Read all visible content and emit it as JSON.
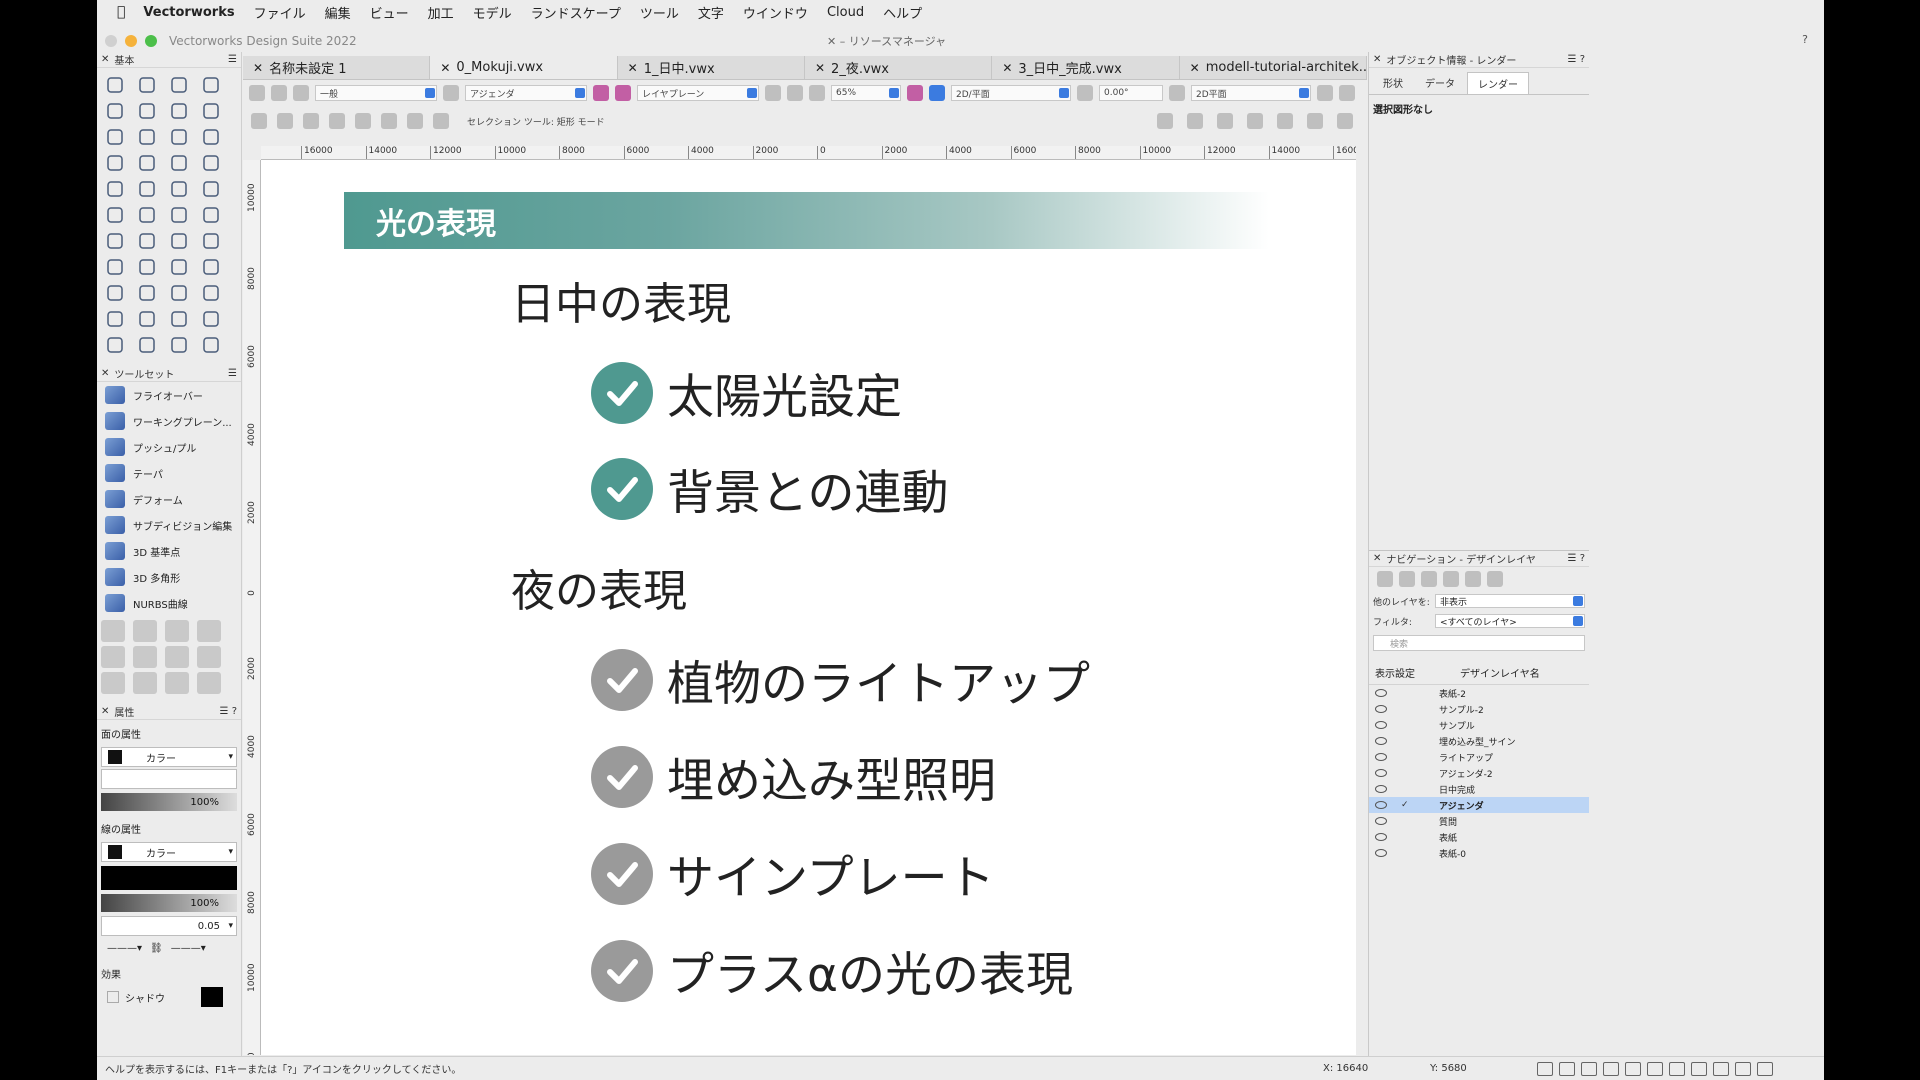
{
  "menubar": {
    "app": "Vectorworks",
    "items": [
      "ファイル",
      "編集",
      "ビュー",
      "加工",
      "モデル",
      "ランドスケープ",
      "ツール",
      "文字",
      "ウインドウ",
      "Cloud",
      "ヘルプ"
    ]
  },
  "window": {
    "title": "Vectorworks Design Suite 2022",
    "resource_manager": "リソースマネージャ",
    "help": "?"
  },
  "tabs": [
    {
      "label": "名称未設定 1",
      "active": false
    },
    {
      "label": "0_Mokuji.vwx",
      "active": true
    },
    {
      "label": "1_日中.vwx",
      "active": false
    },
    {
      "label": "2_夜.vwx",
      "active": false
    },
    {
      "label": "3_日中_完成.vwx",
      "active": false
    },
    {
      "label": "modell-tutorial-architek...",
      "active": false
    }
  ],
  "toolbar": {
    "class_field": "一般",
    "layer_field": "アジェンダ",
    "plane_field": "レイヤプレーン",
    "zoom": "65%",
    "view_field": "2D/平面",
    "rotation": "0.00°",
    "render_field": "2D平面",
    "mode_label": "セレクション ツール: 矩形 モード"
  },
  "panels": {
    "basic": "基本",
    "toolsets": "ツールセット",
    "toolset_items": [
      "フライオーバー",
      "ワーキングプレーン...",
      "プッシュ/プル",
      "テーパ",
      "デフォーム",
      "サブディビジョン編集",
      "3D 基準点",
      "3D 多角形",
      "NURBS曲線"
    ],
    "attributes": "属性",
    "fill_label": "面の属性",
    "fill_type": "カラー",
    "fill_opacity": "100%",
    "line_label": "線の属性",
    "line_type": "カラー",
    "line_opacity": "100%",
    "line_weight": "0.05",
    "effects_label": "効果",
    "shadow_label": "シャドウ"
  },
  "ruler": {
    "h": [
      "16000",
      "14000",
      "12000",
      "10000",
      "8000",
      "6000",
      "4000",
      "2000",
      "0",
      "2000",
      "4000",
      "6000",
      "8000",
      "10000",
      "12000",
      "14000",
      "1600"
    ],
    "v": [
      "10000",
      "8000",
      "6000",
      "4000",
      "2000",
      "0",
      "2000",
      "4000",
      "6000",
      "8000",
      "10000",
      "000"
    ]
  },
  "slide": {
    "banner": "光の表現",
    "day_heading": "日中の表現",
    "day_items": [
      "太陽光設定",
      "背景との連動"
    ],
    "night_heading": "夜の表現",
    "night_items": [
      "植物のライトアップ",
      "埋め込み型照明",
      "サインプレート",
      "プラスαの光の表現"
    ],
    "day_check_color": "#4f9990",
    "night_check_color": "#9a9a9a"
  },
  "object_info": {
    "title": "オブジェクト情報 - レンダー",
    "tabs": [
      "形状",
      "データ",
      "レンダー"
    ],
    "active_tab": "レンダー",
    "no_selection": "選択図形なし"
  },
  "navigation": {
    "title": "ナビゲーション - デザインレイヤ",
    "other_layers_label": "他のレイヤを:",
    "other_layers_value": "非表示",
    "filter_label": "フィルタ:",
    "filter_value": "<すべてのレイヤ>",
    "search_placeholder": "検索",
    "col_visibility": "表示設定",
    "col_name": "デザインレイヤ名",
    "layers": [
      "表紙-2",
      "サンプル-2",
      "サンプル",
      "埋め込み型_サイン",
      "ライトアップ",
      "アジェンダ-2",
      "日中完成",
      "アジェンダ",
      "質問",
      "表紙",
      "表紙-0"
    ],
    "active_layer": "アジェンダ"
  },
  "status": {
    "help": "ヘルプを表示するには、F1キーまたは「?」アイコンをクリックしてください。",
    "x": "X: 16640",
    "y": "Y: 5680"
  }
}
